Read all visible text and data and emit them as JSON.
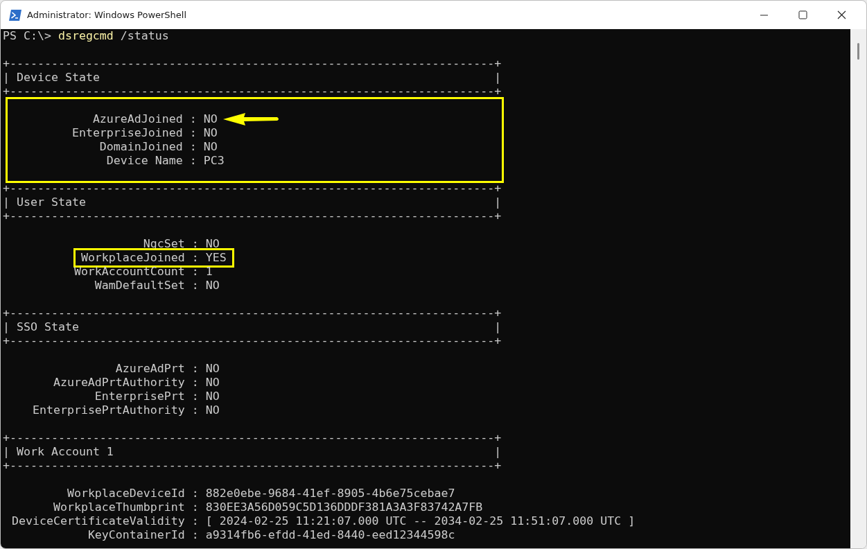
{
  "window": {
    "title": "Administrator: Windows PowerShell"
  },
  "command": {
    "prompt": "PS C:\\>",
    "command": "dsregcmd",
    "argument": "/status"
  },
  "sections": [
    {
      "top_rule": "+----------------------------------------------------------------------+",
      "left": "|",
      "title": "Device State",
      "right": "|",
      "bottom_rule": "+----------------------------------------------------------------------+",
      "highlighted": true,
      "fields": [
        {
          "key": "AzureAdJoined",
          "sep": ":",
          "value": "NO",
          "highlighted": false,
          "arrow": true
        },
        {
          "key": "EnterpriseJoined",
          "sep": ":",
          "value": "NO",
          "highlighted": false,
          "arrow": false
        },
        {
          "key": "DomainJoined",
          "sep": ":",
          "value": "NO",
          "highlighted": false,
          "arrow": false
        },
        {
          "key": "Device Name",
          "sep": ":",
          "value": "PC3",
          "highlighted": false,
          "arrow": false
        }
      ]
    },
    {
      "top_rule": "+----------------------------------------------------------------------+",
      "left": "|",
      "title": "User State",
      "right": "|",
      "bottom_rule": "+----------------------------------------------------------------------+",
      "highlighted": false,
      "fields": [
        {
          "key": "NgcSet",
          "sep": ":",
          "value": "NO",
          "highlighted": false,
          "arrow": false
        },
        {
          "key": "WorkplaceJoined",
          "sep": ":",
          "value": "YES",
          "highlighted": true,
          "arrow": false
        },
        {
          "key": "WorkAccountCount",
          "sep": ":",
          "value": "1",
          "highlighted": false,
          "arrow": false
        },
        {
          "key": "WamDefaultSet",
          "sep": ":",
          "value": "NO",
          "highlighted": false,
          "arrow": false
        }
      ]
    },
    {
      "top_rule": "+----------------------------------------------------------------------+",
      "left": "|",
      "title": "SSO State",
      "right": "|",
      "bottom_rule": "+----------------------------------------------------------------------+",
      "highlighted": false,
      "fields": [
        {
          "key": "AzureAdPrt",
          "sep": ":",
          "value": "NO",
          "highlighted": false,
          "arrow": false
        },
        {
          "key": "AzureAdPrtAuthority",
          "sep": ":",
          "value": "NO",
          "highlighted": false,
          "arrow": false
        },
        {
          "key": "EnterprisePrt",
          "sep": ":",
          "value": "NO",
          "highlighted": false,
          "arrow": false
        },
        {
          "key": "EnterprisePrtAuthority",
          "sep": ":",
          "value": "NO",
          "highlighted": false,
          "arrow": false
        }
      ]
    },
    {
      "top_rule": "+----------------------------------------------------------------------+",
      "left": "|",
      "title": "Work Account 1",
      "right": "|",
      "bottom_rule": "+----------------------------------------------------------------------+",
      "highlighted": false,
      "fields": [
        {
          "key": "WorkplaceDeviceId",
          "sep": ":",
          "value": "882e0ebe-9684-41ef-8905-4b6e75cebae7",
          "highlighted": false,
          "arrow": false
        },
        {
          "key": "WorkplaceThumbprint",
          "sep": ":",
          "value": "830EE3A56D059C5D136DDDF381A3A3F83742A7FB",
          "highlighted": false,
          "arrow": false
        },
        {
          "key": "DeviceCertificateValidity",
          "sep": ":",
          "value": "[ 2024-02-25 11:21:07.000 UTC -- 2034-02-25 11:51:07.000 UTC ]",
          "highlighted": false,
          "arrow": false
        },
        {
          "key": "KeyContainerId",
          "sep": ":",
          "value": "a9314fb6-efdd-41ed-8440-eed12344598c",
          "highlighted": false,
          "arrow": false
        }
      ]
    }
  ]
}
